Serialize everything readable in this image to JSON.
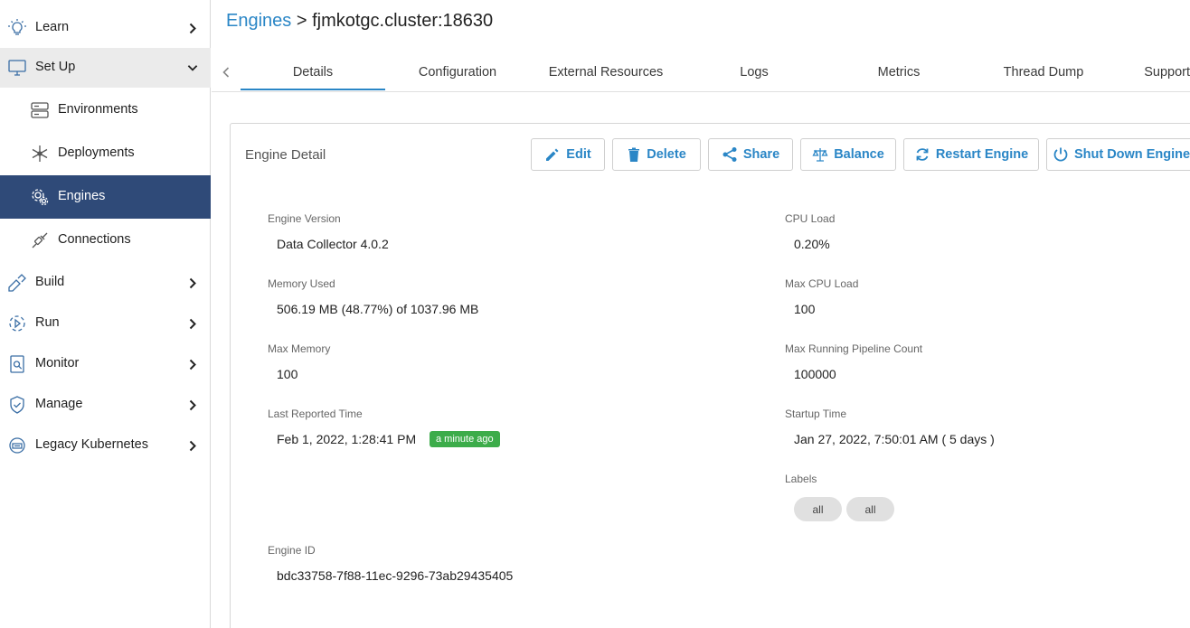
{
  "sidebar": {
    "items": [
      {
        "label": "Learn",
        "icon": "lightbulb-icon"
      },
      {
        "label": "Set Up",
        "icon": "monitor-icon"
      },
      {
        "label": "Environments",
        "icon": "server-icon"
      },
      {
        "label": "Deployments",
        "icon": "snowflake-icon"
      },
      {
        "label": "Engines",
        "icon": "gears-icon"
      },
      {
        "label": "Connections",
        "icon": "plug-icon"
      },
      {
        "label": "Build",
        "icon": "build-icon"
      },
      {
        "label": "Run",
        "icon": "run-icon"
      },
      {
        "label": "Monitor",
        "icon": "report-icon"
      },
      {
        "label": "Manage",
        "icon": "shield-icon"
      },
      {
        "label": "Legacy Kubernetes",
        "icon": "kubernetes-icon"
      }
    ]
  },
  "breadcrumb": {
    "link": "Engines",
    "separator": " > ",
    "current": "fjmkotgc.cluster:18630"
  },
  "tabs": [
    "Details",
    "Configuration",
    "External Resources",
    "Logs",
    "Metrics",
    "Thread Dump",
    "Support"
  ],
  "card": {
    "title": "Engine Detail",
    "buttons": [
      "Edit",
      "Delete",
      "Share",
      "Balance",
      "Restart Engine",
      "Shut Down Engine"
    ]
  },
  "fields": {
    "engine_version": {
      "label": "Engine Version",
      "value": "Data Collector 4.0.2"
    },
    "memory_used": {
      "label": "Memory Used",
      "value": "506.19 MB (48.77%) of 1037.96 MB"
    },
    "max_memory": {
      "label": "Max Memory",
      "value": "100"
    },
    "last_reported": {
      "label": "Last Reported Time",
      "value": "Feb 1, 2022, 1:28:41 PM",
      "badge": "a minute ago"
    },
    "engine_id": {
      "label": "Engine ID",
      "value": "bdc33758-7f88-11ec-9296-73ab29435405"
    },
    "cpu_load": {
      "label": "CPU Load",
      "value": "0.20%"
    },
    "max_cpu_load": {
      "label": "Max CPU Load",
      "value": "100"
    },
    "max_pipelines": {
      "label": "Max Running Pipeline Count",
      "value": "100000"
    },
    "startup_time": {
      "label": "Startup Time",
      "value": "Jan 27, 2022, 7:50:01 AM ( 5 days )"
    },
    "labels": {
      "label": "Labels",
      "values": [
        "all",
        "all"
      ]
    }
  },
  "colors": {
    "accent": "#2a86c6",
    "nav_active": "#2f4a78",
    "badge_green": "#3cac4a"
  }
}
